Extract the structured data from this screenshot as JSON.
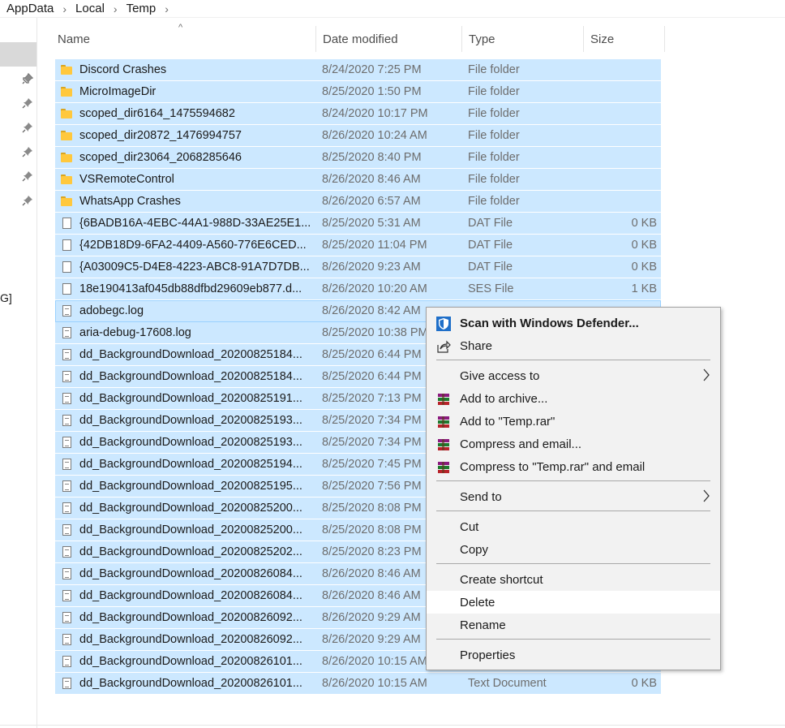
{
  "breadcrumb": [
    {
      "label": "AppData"
    },
    {
      "label": "Local"
    },
    {
      "label": "Temp"
    }
  ],
  "nav": {
    "truncated_label": "G]"
  },
  "columns": {
    "name": "Name",
    "date": "Date modified",
    "type": "Type",
    "size": "Size"
  },
  "files": [
    {
      "name": "Discord Crashes",
      "date": "8/24/2020 7:25 PM",
      "type": "File folder",
      "size": "",
      "icon": "folder-icon"
    },
    {
      "name": "MicroImageDir",
      "date": "8/25/2020 1:50 PM",
      "type": "File folder",
      "size": "",
      "icon": "folder-icon"
    },
    {
      "name": "scoped_dir6164_1475594682",
      "date": "8/24/2020 10:17 PM",
      "type": "File folder",
      "size": "",
      "icon": "folder-icon"
    },
    {
      "name": "scoped_dir20872_1476994757",
      "date": "8/26/2020 10:24 AM",
      "type": "File folder",
      "size": "",
      "icon": "folder-icon"
    },
    {
      "name": "scoped_dir23064_2068285646",
      "date": "8/25/2020 8:40 PM",
      "type": "File folder",
      "size": "",
      "icon": "folder-icon"
    },
    {
      "name": "VSRemoteControl",
      "date": "8/26/2020 8:46 AM",
      "type": "File folder",
      "size": "",
      "icon": "folder-icon"
    },
    {
      "name": "WhatsApp Crashes",
      "date": "8/26/2020 6:57 AM",
      "type": "File folder",
      "size": "",
      "icon": "folder-icon"
    },
    {
      "name": "{6BADB16A-4EBC-44A1-988D-33AE25E1...",
      "date": "8/25/2020 5:31 AM",
      "type": "DAT File",
      "size": "0 KB",
      "icon": "file-icon"
    },
    {
      "name": "{42DB18D9-6FA2-4409-A560-776E6CED...",
      "date": "8/25/2020 11:04 PM",
      "type": "DAT File",
      "size": "0 KB",
      "icon": "file-icon"
    },
    {
      "name": "{A03009C5-D4E8-4223-ABC8-91A7D7DB...",
      "date": "8/26/2020 9:23 AM",
      "type": "DAT File",
      "size": "0 KB",
      "icon": "file-icon"
    },
    {
      "name": "18e190413af045db88dfbd29609eb877.d...",
      "date": "8/26/2020 10:20 AM",
      "type": "SES File",
      "size": "1 KB",
      "icon": "file-icon"
    },
    {
      "name": "adobegc.log",
      "date": "8/26/2020 8:42 AM",
      "type": "",
      "size": "",
      "icon": "text-file-icon"
    },
    {
      "name": "aria-debug-17608.log",
      "date": "8/25/2020 10:38 PM",
      "type": "",
      "size": "",
      "icon": "text-file-icon"
    },
    {
      "name": "dd_BackgroundDownload_20200825184...",
      "date": "8/25/2020 6:44 PM",
      "type": "",
      "size": "",
      "icon": "text-file-icon"
    },
    {
      "name": "dd_BackgroundDownload_20200825184...",
      "date": "8/25/2020 6:44 PM",
      "type": "",
      "size": "",
      "icon": "text-file-icon"
    },
    {
      "name": "dd_BackgroundDownload_20200825191...",
      "date": "8/25/2020 7:13 PM",
      "type": "",
      "size": "",
      "icon": "text-file-icon"
    },
    {
      "name": "dd_BackgroundDownload_20200825193...",
      "date": "8/25/2020 7:34 PM",
      "type": "",
      "size": "",
      "icon": "text-file-icon"
    },
    {
      "name": "dd_BackgroundDownload_20200825193...",
      "date": "8/25/2020 7:34 PM",
      "type": "",
      "size": "",
      "icon": "text-file-icon"
    },
    {
      "name": "dd_BackgroundDownload_20200825194...",
      "date": "8/25/2020 7:45 PM",
      "type": "",
      "size": "",
      "icon": "text-file-icon"
    },
    {
      "name": "dd_BackgroundDownload_20200825195...",
      "date": "8/25/2020 7:56 PM",
      "type": "",
      "size": "",
      "icon": "text-file-icon"
    },
    {
      "name": "dd_BackgroundDownload_20200825200...",
      "date": "8/25/2020 8:08 PM",
      "type": "",
      "size": "",
      "icon": "text-file-icon"
    },
    {
      "name": "dd_BackgroundDownload_20200825200...",
      "date": "8/25/2020 8:08 PM",
      "type": "",
      "size": "",
      "icon": "text-file-icon"
    },
    {
      "name": "dd_BackgroundDownload_20200825202...",
      "date": "8/25/2020 8:23 PM",
      "type": "",
      "size": "",
      "icon": "text-file-icon"
    },
    {
      "name": "dd_BackgroundDownload_20200826084...",
      "date": "8/26/2020 8:46 AM",
      "type": "",
      "size": "",
      "icon": "text-file-icon"
    },
    {
      "name": "dd_BackgroundDownload_20200826084...",
      "date": "8/26/2020 8:46 AM",
      "type": "",
      "size": "",
      "icon": "text-file-icon"
    },
    {
      "name": "dd_BackgroundDownload_20200826092...",
      "date": "8/26/2020 9:29 AM",
      "type": "",
      "size": "",
      "icon": "text-file-icon"
    },
    {
      "name": "dd_BackgroundDownload_20200826092...",
      "date": "8/26/2020 9:29 AM",
      "type": "",
      "size": "",
      "icon": "text-file-icon"
    },
    {
      "name": "dd_BackgroundDownload_20200826101...",
      "date": "8/26/2020 10:15 AM",
      "type": "",
      "size": "",
      "icon": "text-file-icon"
    },
    {
      "name": "dd_BackgroundDownload_20200826101...",
      "date": "8/26/2020 10:15 AM",
      "type": "Text Document",
      "size": "0 KB",
      "icon": "text-file-icon"
    }
  ],
  "context_menu": {
    "items": [
      {
        "label": "Scan with Windows Defender...",
        "icon": "windows-defender-icon"
      },
      {
        "label": "Share",
        "icon": "share-icon"
      },
      {
        "label": "Give access to",
        "icon": ""
      },
      {
        "label": "Add to archive...",
        "icon": "winrar-icon"
      },
      {
        "label": "Add to \"Temp.rar\"",
        "icon": "winrar-icon"
      },
      {
        "label": "Compress and email...",
        "icon": "winrar-icon"
      },
      {
        "label": "Compress to \"Temp.rar\" and email",
        "icon": "winrar-icon"
      },
      {
        "label": "Send to",
        "icon": ""
      },
      {
        "label": "Cut",
        "icon": ""
      },
      {
        "label": "Copy",
        "icon": ""
      },
      {
        "label": "Create shortcut",
        "icon": ""
      },
      {
        "label": "Delete",
        "icon": ""
      },
      {
        "label": "Rename",
        "icon": ""
      },
      {
        "label": "Properties",
        "icon": ""
      }
    ]
  },
  "colors": {
    "selection": "#cce8ff",
    "menu_bg": "#f2f2f2",
    "menu_hover": "#ffffff",
    "folder": "#ffc83d"
  }
}
